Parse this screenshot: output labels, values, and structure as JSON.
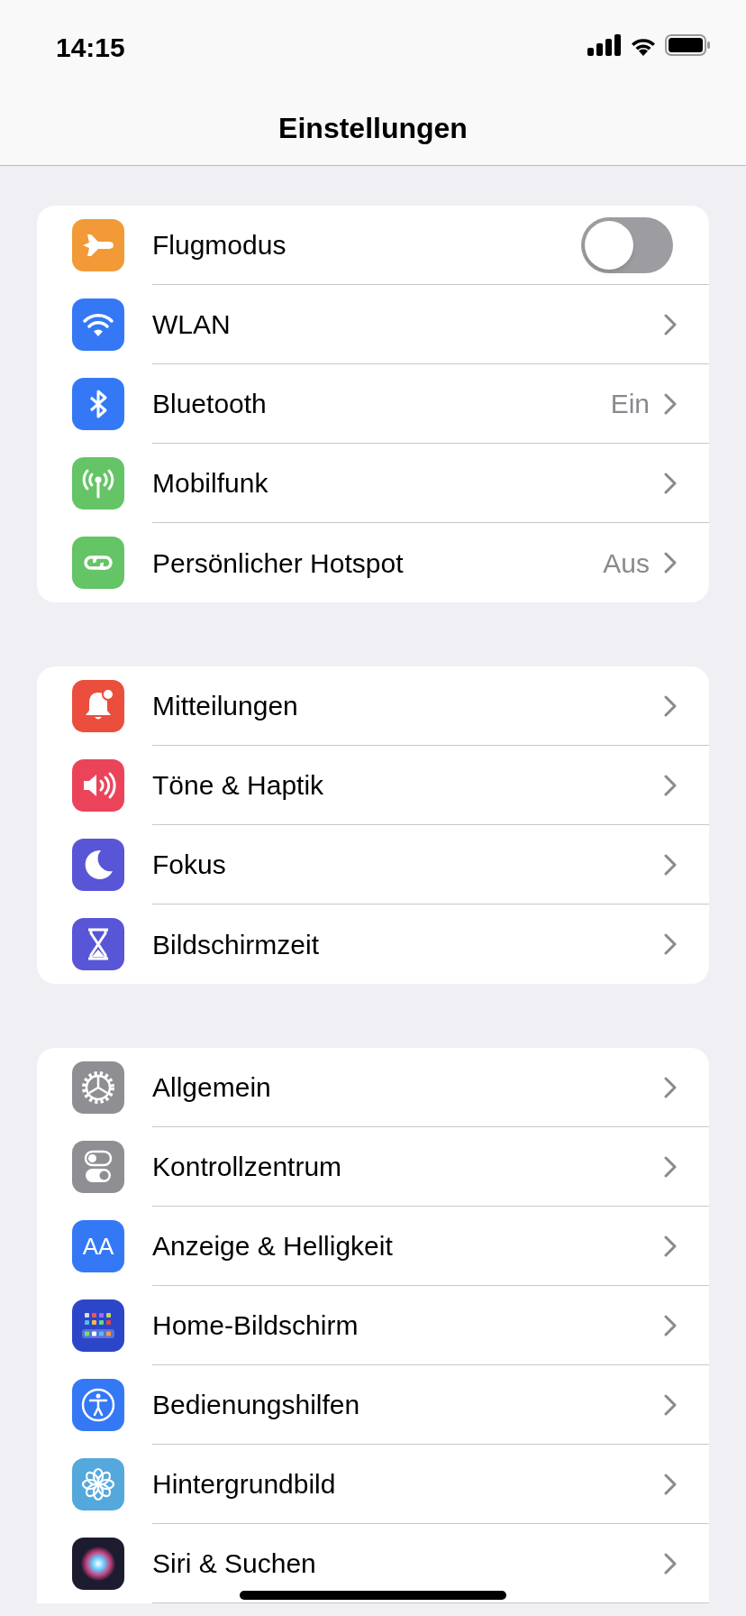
{
  "status_bar": {
    "time": "14:15"
  },
  "nav": {
    "title": "Einstellungen"
  },
  "groups": [
    {
      "cut_off": false,
      "rows": [
        {
          "kind": "toggle",
          "label": "Flugmodus",
          "color": "#f19a37",
          "on": false
        },
        {
          "kind": "link",
          "label": "WLAN",
          "color": "#3478f6"
        },
        {
          "kind": "link",
          "label": "Bluetooth",
          "color": "#3478f6",
          "value": "Ein"
        },
        {
          "kind": "link",
          "label": "Mobilfunk",
          "color": "#65c466"
        },
        {
          "kind": "link",
          "label": "Persönlicher Hotspot",
          "color": "#65c466",
          "value": "Aus"
        }
      ]
    },
    {
      "cut_off": false,
      "rows": [
        {
          "kind": "link",
          "label": "Mitteilungen",
          "color": "#eb4e3d"
        },
        {
          "kind": "link",
          "label": "Töne & Haptik",
          "color": "#eb445a"
        },
        {
          "kind": "link",
          "label": "Fokus",
          "color": "#5856d6"
        },
        {
          "kind": "link",
          "label": "Bildschirmzeit",
          "color": "#5856d6"
        }
      ]
    },
    {
      "cut_off": true,
      "rows": [
        {
          "kind": "link",
          "label": "Allgemein",
          "color": "#8e8e93"
        },
        {
          "kind": "link",
          "label": "Kontrollzentrum",
          "color": "#8e8e93"
        },
        {
          "kind": "link",
          "label": "Anzeige & Helligkeit",
          "color": "#3478f6",
          "icon_text": "AA"
        },
        {
          "kind": "link",
          "label": "Home-Bildschirm",
          "color": "#2c46c9"
        },
        {
          "kind": "link",
          "label": "Bedienungshilfen",
          "color": "#3478f6"
        },
        {
          "kind": "link",
          "label": "Hintergrundbild",
          "color": "#55a8dc"
        },
        {
          "kind": "link",
          "label": "Siri & Suchen",
          "color": "#1c1c2e"
        }
      ]
    }
  ]
}
